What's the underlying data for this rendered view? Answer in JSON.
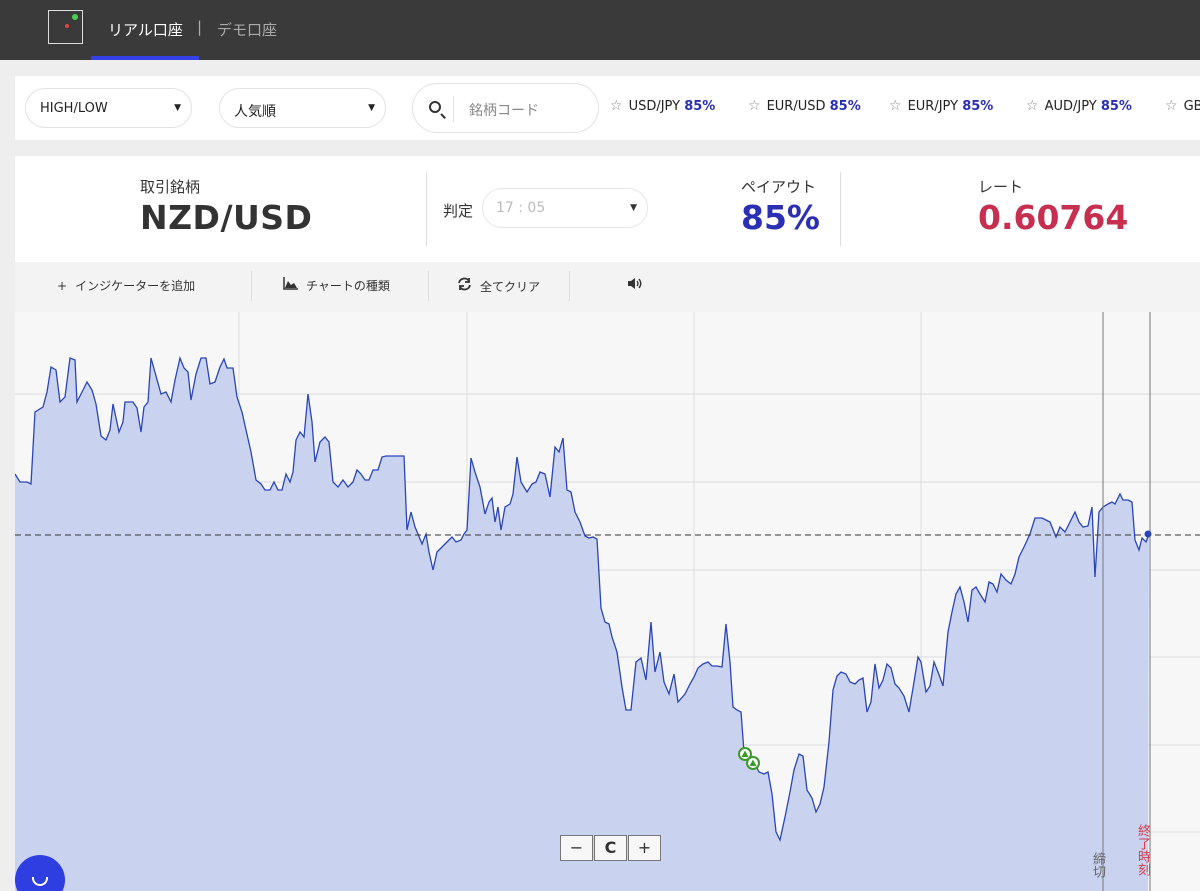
{
  "header": {
    "tab_real": "リアル口座",
    "separator": "|",
    "tab_demo": "デモ口座"
  },
  "filters": {
    "type_select": "HIGH/LOW",
    "sort_select": "人気順",
    "search_placeholder": "銘柄コード"
  },
  "favorites": [
    {
      "pair": "USD/JPY",
      "payout": "85%"
    },
    {
      "pair": "EUR/USD",
      "payout": "85%"
    },
    {
      "pair": "EUR/JPY",
      "payout": "85%"
    },
    {
      "pair": "AUD/JPY",
      "payout": "85%"
    },
    {
      "pair": "GB",
      "payout": ""
    }
  ],
  "instrument": {
    "symbol_label": "取引銘柄",
    "symbol": "NZD/USD",
    "judge_label": "判定",
    "judge_time": "17 : 05",
    "payout_label": "ペイアウト",
    "payout": "85%",
    "rate_label": "レート",
    "rate": "0.60764"
  },
  "toolbar": {
    "add_indicator": "インジケーターを追加",
    "chart_type": "チャートの種類",
    "clear_all": "全てクリア"
  },
  "chart": {
    "closing_label": "締切",
    "expiry_label": "終了時刻",
    "zoom_out": "−",
    "reset": "C",
    "zoom_in": "+"
  },
  "colors": {
    "accent_blue": "#2a2fb4",
    "rate_red": "#c62f4f",
    "line_blue": "#2a45b8",
    "area_fill": "#c9d3f0",
    "marker_green": "#3a9a2a"
  }
}
